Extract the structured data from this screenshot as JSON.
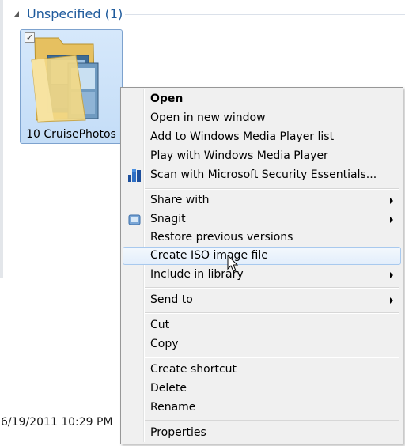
{
  "group": {
    "title": "Unspecified (1)"
  },
  "folder": {
    "name": "10 CruisePhotos",
    "checked": true
  },
  "status": {
    "date": "6/19/2011 10:29 PM"
  },
  "context_menu": {
    "items": [
      {
        "label": "Open",
        "bold": true
      },
      {
        "label": "Open in new window"
      },
      {
        "label": "Add to Windows Media Player list"
      },
      {
        "label": "Play with Windows Media Player"
      },
      {
        "label": "Scan with Microsoft Security Essentials...",
        "icon": "security-essentials-icon"
      },
      {
        "label": "Share with",
        "submenu": true
      },
      {
        "label": "Snagit",
        "submenu": true,
        "icon": "snagit-icon"
      },
      {
        "label": "Restore previous versions"
      },
      {
        "label": "Create ISO image file",
        "highlighted": true
      },
      {
        "label": "Include in library",
        "submenu": true
      },
      {
        "label": "Send to",
        "submenu": true
      },
      {
        "label": "Cut"
      },
      {
        "label": "Copy"
      },
      {
        "label": "Create shortcut"
      },
      {
        "label": "Delete"
      },
      {
        "label": "Rename"
      },
      {
        "label": "Properties"
      }
    ]
  },
  "colors": {
    "group_title": "#1e5a9c",
    "selection": "#cce4fc",
    "menu_bg": "#f0f0f0",
    "highlight_border": "#a8c9ee"
  }
}
